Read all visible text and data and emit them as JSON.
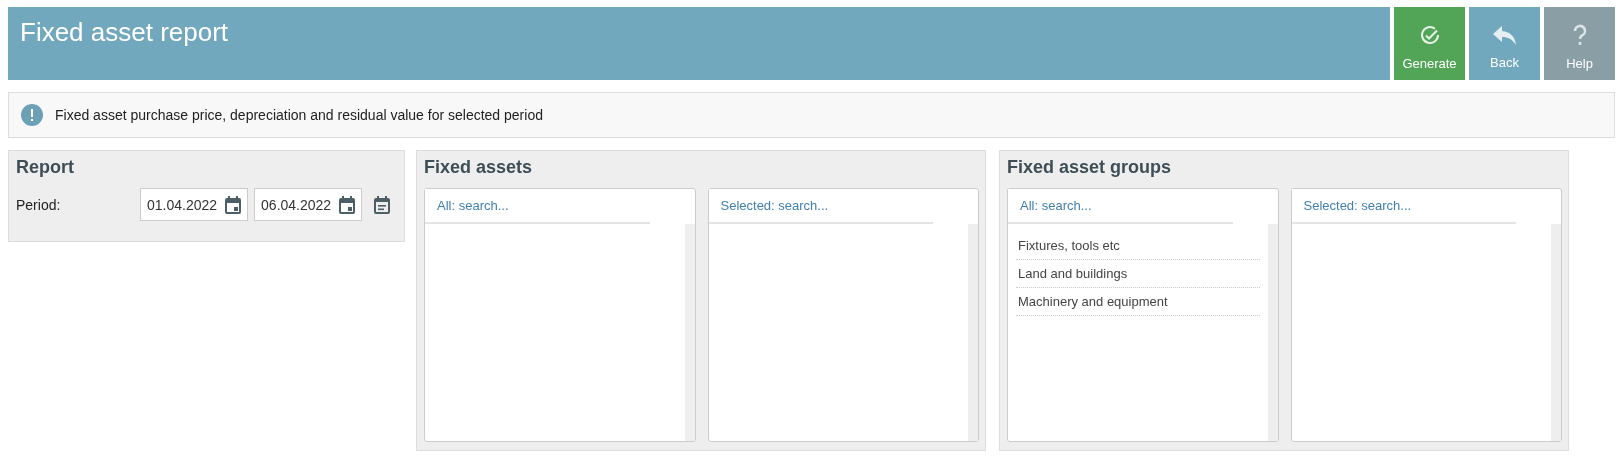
{
  "header": {
    "title": "Fixed asset report",
    "buttons": [
      {
        "label": "Generate",
        "kind": "generate"
      },
      {
        "label": "Back",
        "kind": "back"
      },
      {
        "label": "Help",
        "kind": "help"
      }
    ]
  },
  "info": {
    "text": "Fixed asset purchase price, depreciation and residual value for selected period"
  },
  "report": {
    "title": "Report",
    "period_label": "Period:",
    "from": "01.04.2022",
    "to": "06.04.2022"
  },
  "pickers": [
    {
      "title": "Fixed assets",
      "all_placeholder": "All: search...",
      "selected_placeholder": "Selected: search..."
    },
    {
      "title": "Fixed asset groups",
      "all_placeholder": "All: search...",
      "selected_placeholder": "Selected: search...",
      "all_items": [
        "Fixtures, tools etc",
        "Land and buildings",
        "Machinery and equipment"
      ]
    }
  ]
}
